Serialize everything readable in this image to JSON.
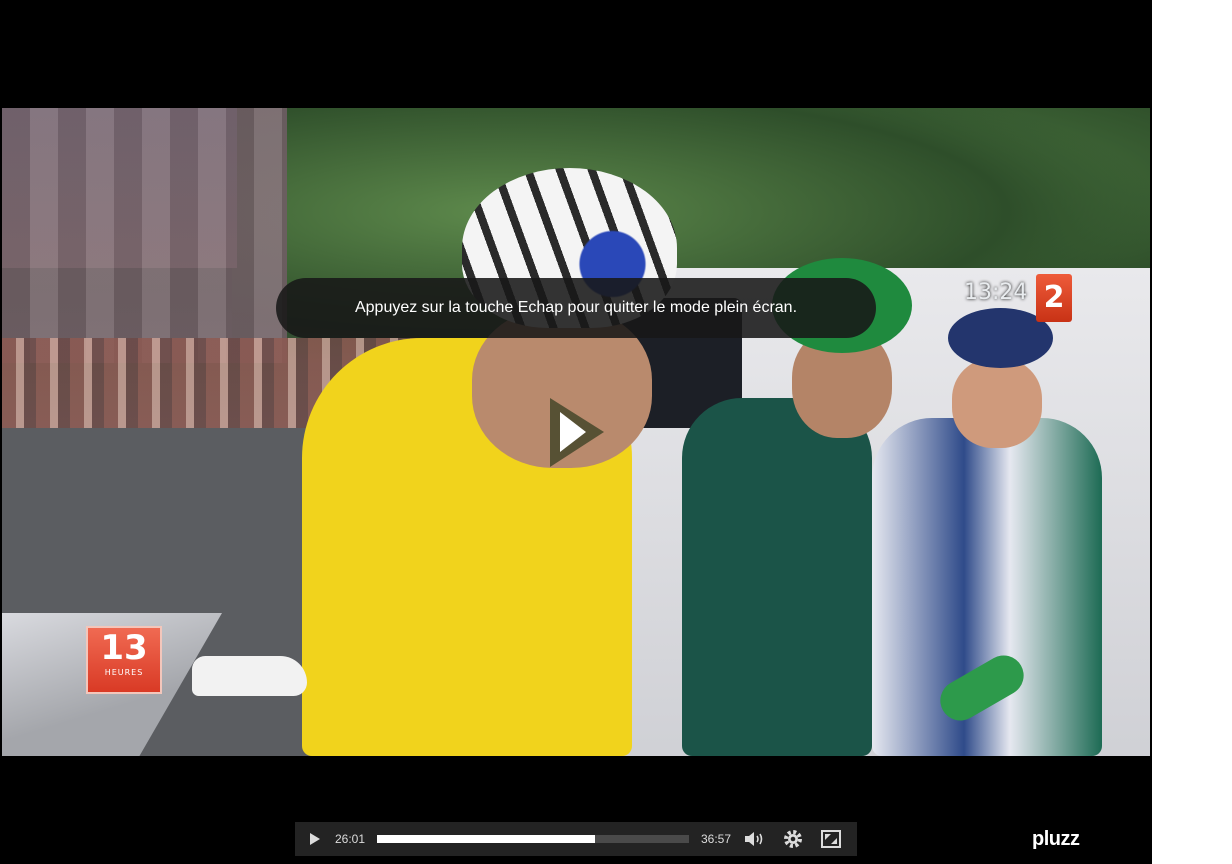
{
  "player": {
    "fullscreen_notice": "Appuyez sur la touche Echap pour quitter le mode plein écran.",
    "current_time": "26:01",
    "duration": "36:57",
    "progress_fraction": 0.7,
    "brand": "pluzz"
  },
  "video": {
    "clock": "13:24",
    "channel_number": "2",
    "show_logo_number": "13",
    "show_logo_sub": "HEURES"
  },
  "icons": {
    "play": "play-icon",
    "volume": "volume-icon",
    "settings": "gear-icon",
    "fullscreen": "exit-fullscreen-icon"
  },
  "colors": {
    "accent": "#ffffff",
    "controlbar_bg": "#232323",
    "channel_red": "#d93a25"
  }
}
